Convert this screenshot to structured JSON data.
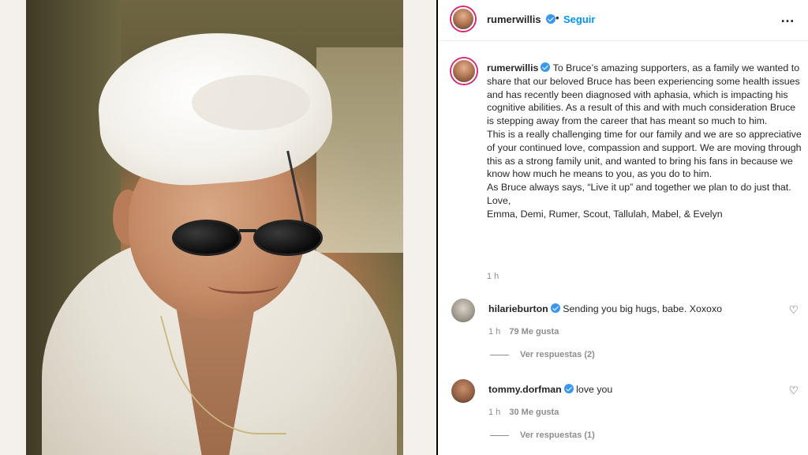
{
  "post": {
    "username": "rumerwillis",
    "separator": "•",
    "follow_label": "Seguir",
    "more_icon": "…",
    "caption": {
      "intro": "To Bruce’s amazing supporters, as a family we wanted to share that our beloved Bruce has been experiencing some health issues and has recently been diagnosed with aphasia, which is impacting his cognitive abilities. As a result of this and with much consideration Bruce is stepping away from the career that has meant so much to him.",
      "p2": "This is a really challenging time for our family and we are so appreciative of your continued love, compassion and support. We are moving through this as a strong family unit, and wanted to bring his fans in because we know how much he means to you, as you do to him.",
      "p3": "As Bruce always says, “Live it up” and together we plan to do just that.",
      "p4": "Love,",
      "p5": "Emma, Demi, Rumer, Scout, Tallulah, Mabel, & Evelyn"
    },
    "time": "1 h"
  },
  "comments": [
    {
      "username": "hilarieburton",
      "text": "Sending you big hugs, babe. Xoxoxo",
      "time": "1 h",
      "likes": "79 Me gusta",
      "replies": "Ver respuestas (2)"
    },
    {
      "username": "tommy.dorfman",
      "text": "love you",
      "time": "1 h",
      "likes": "30 Me gusta",
      "replies": "Ver respuestas (1)"
    }
  ],
  "icons": {
    "heart": "♡",
    "verified_color": "#3897f0",
    "follow_color": "#0095f6"
  }
}
